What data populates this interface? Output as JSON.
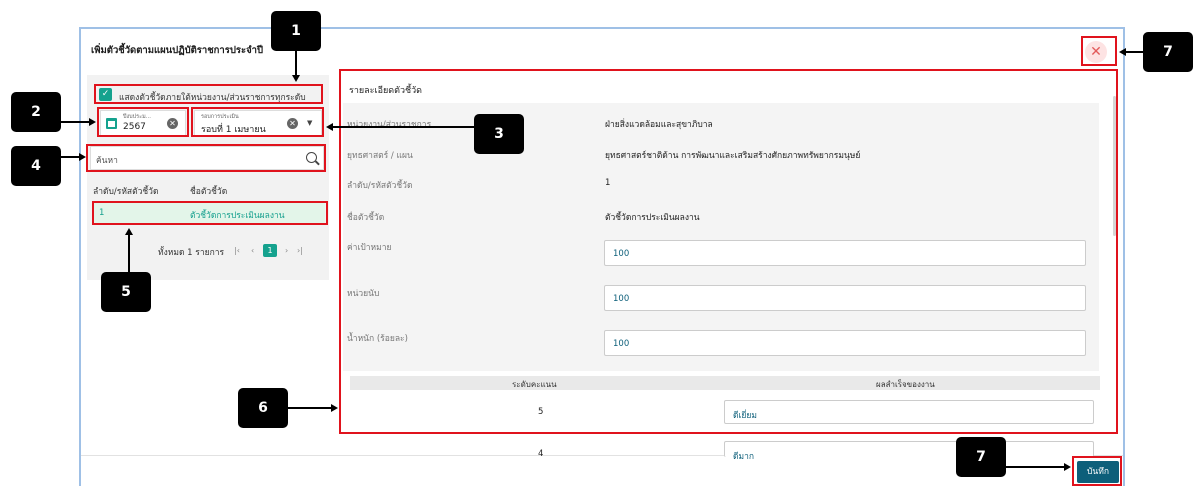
{
  "dialog": {
    "title": "เพิ่มตัวชี้วัดตามแผนปฏิบัติราชการประจำปี",
    "close_icon": "✕",
    "save_label": "บันทึก"
  },
  "filters": {
    "show_all_label": "แสดงตัวชี้วัดภายใต้หน่วยงาน/ส่วนราชการทุกระดับ",
    "year_caption": "ปีงบประม...",
    "year_value": "2567",
    "round_caption": "รอบการประเมิน",
    "round_value": "รอบที่ 1 เมษายน",
    "search_placeholder": "ค้นหา"
  },
  "indicator_list": {
    "columns": [
      "ลำดับ/รหัสตัวชี้วัด",
      "ชื่อตัวชี้วัด"
    ],
    "rows": [
      {
        "no": "1",
        "name": "ตัวชี้วัดการประเมินผลงาน"
      }
    ],
    "pagination": {
      "total_text": "ทั้งหมด 1 รายการ",
      "first": "|‹",
      "prev": "‹",
      "current": "1",
      "next": "›",
      "last": "›|"
    }
  },
  "details": {
    "title": "รายละเอียดตัวชี้วัด",
    "fields": [
      {
        "label": "หน่วยงาน/ส่วนราชการ",
        "value": "ฝ่ายสิ่งแวดล้อมและสุขาภิบาล"
      },
      {
        "label": "ยุทธศาสตร์ / แผน",
        "value": "ยุทธศาสตร์ชาติด้าน การพัฒนาและเสริมสร้างศักยภาพทรัพยากรมนุษย์"
      },
      {
        "label": "ลำดับ/รหัสตัวชี้วัด",
        "value": "1"
      },
      {
        "label": "ชื่อตัวชี้วัด",
        "value": "ตัวชี้วัดการประเมินผลงาน"
      }
    ],
    "inputs": [
      {
        "label": "ค่าเป้าหมาย",
        "value": "100"
      },
      {
        "label": "หน่วยนับ",
        "value": "100"
      },
      {
        "label": "น้ำหนัก (ร้อยละ)",
        "value": "100"
      }
    ],
    "score_table": {
      "headers": [
        "ระดับคะแนน",
        "ผลสำเร็จของงาน"
      ],
      "rows": [
        {
          "score": "5",
          "result": "ดีเยี่ยม"
        },
        {
          "score": "4",
          "result": "ดีมาก"
        }
      ]
    }
  },
  "annotations": [
    "1",
    "2",
    "3",
    "4",
    "5",
    "6",
    "7",
    "7"
  ],
  "colors": {
    "accent": "#15a28e",
    "primary_button": "#0d5f7a",
    "highlight": "#e0131d",
    "selected_row": "#e3f5e9"
  }
}
